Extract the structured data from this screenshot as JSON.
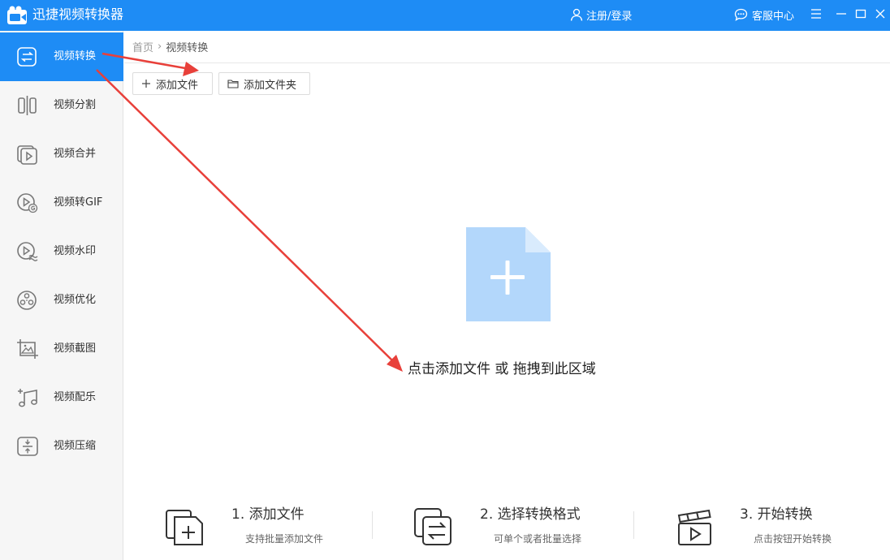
{
  "app": {
    "title": "迅捷视频转换器"
  },
  "header": {
    "login_label": "注册/登录",
    "service_label": "客服中心"
  },
  "sidebar": {
    "items": [
      {
        "label": "视频转换",
        "icon": "convert-icon",
        "active": true
      },
      {
        "label": "视频分割",
        "icon": "split-icon"
      },
      {
        "label": "视频合并",
        "icon": "merge-icon"
      },
      {
        "label": "视频转GIF",
        "icon": "gif-icon"
      },
      {
        "label": "视频水印",
        "icon": "watermark-icon"
      },
      {
        "label": "视频优化",
        "icon": "optimize-icon"
      },
      {
        "label": "视频截图",
        "icon": "screenshot-icon"
      },
      {
        "label": "视频配乐",
        "icon": "music-icon"
      },
      {
        "label": "视频压缩",
        "icon": "compress-icon"
      }
    ]
  },
  "breadcrumb": {
    "home": "首页",
    "separator": "›",
    "current": "视频转换"
  },
  "toolbar": {
    "add_file_label": "添加文件",
    "add_folder_label": "添加文件夹"
  },
  "dropzone": {
    "hint": "点击添加文件 或 拖拽到此区域"
  },
  "steps": [
    {
      "title": "1. 添加文件",
      "desc": "支持批量添加文件",
      "icon": "add-file-step-icon"
    },
    {
      "title": "2. 选择转换格式",
      "desc": "可单个或者批量选择",
      "icon": "format-step-icon"
    },
    {
      "title": "3. 开始转换",
      "desc": "点击按钮开始转换",
      "icon": "start-step-icon"
    }
  ],
  "colors": {
    "brand": "#1e8cf5",
    "drop_file": "#b3d7fb",
    "annotation_arrow": "#e8403a"
  }
}
